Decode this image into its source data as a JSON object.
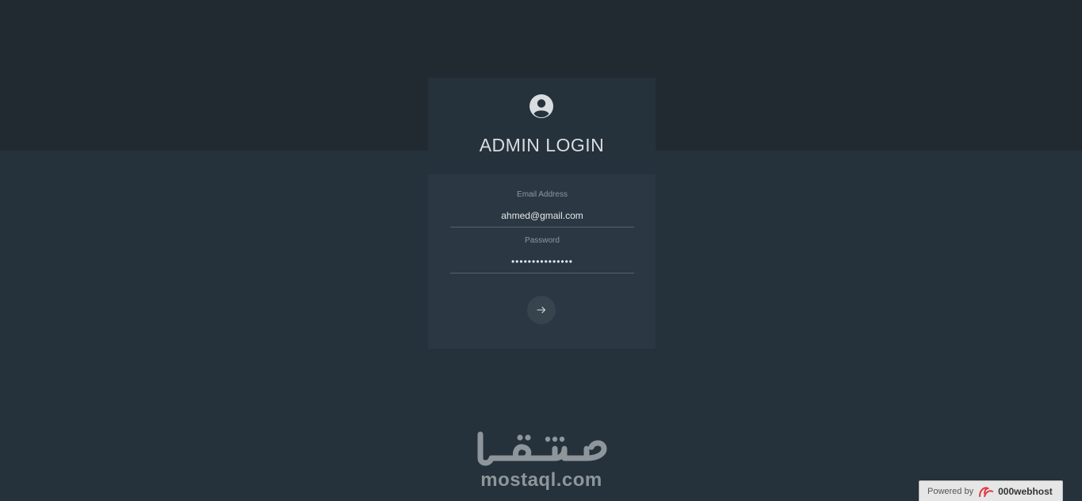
{
  "header": {
    "title": "ADMIN LOGIN",
    "icon": "user-circle-icon"
  },
  "form": {
    "email_label": "Email Address",
    "email_value": "ahmed@gmail.com",
    "password_label": "Password",
    "password_value": "•••••••••••••••",
    "submit_icon": "arrow-right-icon"
  },
  "watermark": {
    "latin": "mostaql.com",
    "arabic": "مستقل"
  },
  "footer": {
    "powered_by": "Powered by",
    "host_name": "000webhost",
    "host_logo": "000webhost-logo"
  },
  "colors": {
    "background": "#25313b",
    "top_band": "#222a31",
    "card_body": "#2b3843",
    "accent_red": "#e0393e"
  }
}
